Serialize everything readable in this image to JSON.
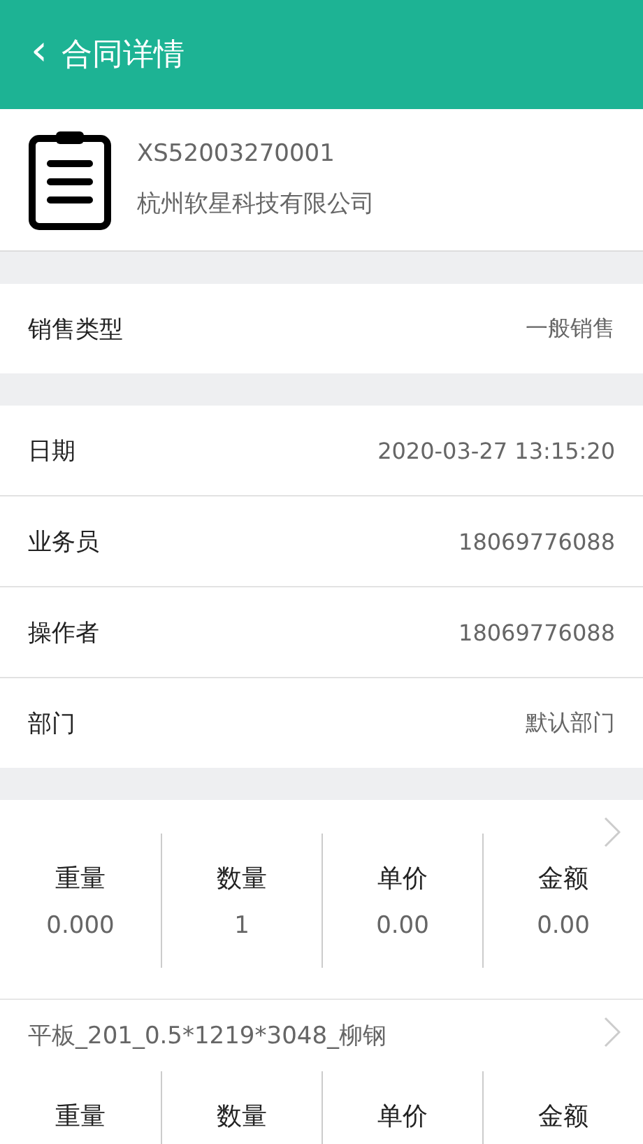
{
  "header": {
    "back_icon": "‹",
    "title": "合同详情"
  },
  "contract": {
    "number": "XS52003270001",
    "company": "杭州软星科技有限公司"
  },
  "sections": [
    [
      {
        "label": "销售类型",
        "value": "一般销售"
      }
    ],
    [
      {
        "label": "日期",
        "value": "2020-03-27 13:15:20"
      },
      {
        "label": "业务员",
        "value": "18069776088"
      },
      {
        "label": "操作者",
        "value": "18069776088"
      },
      {
        "label": "部门",
        "value": "默认部门"
      }
    ]
  ],
  "items": [
    {
      "stats": [
        {
          "label": "重量",
          "value": "0.000"
        },
        {
          "label": "数量",
          "value": "1"
        },
        {
          "label": "单价",
          "value": "0.00"
        },
        {
          "label": "金额",
          "value": "0.00"
        }
      ]
    },
    {
      "name": "平板_201_0.5*1219*3048_柳钢",
      "stats": [
        {
          "label": "重量"
        },
        {
          "label": "数量"
        },
        {
          "label": "单价"
        },
        {
          "label": "金额"
        }
      ]
    }
  ]
}
